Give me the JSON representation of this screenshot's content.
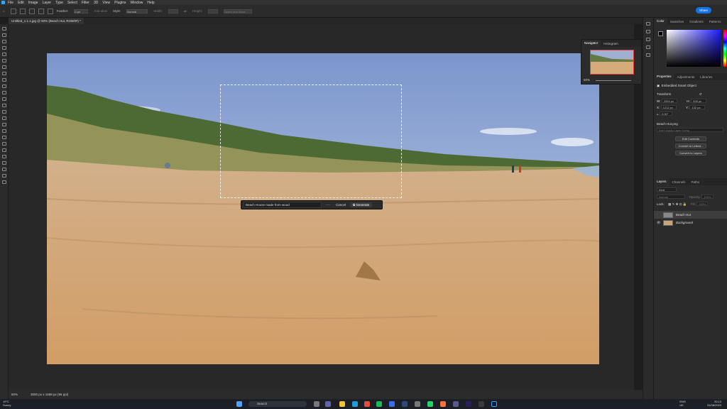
{
  "menubar": {
    "items": [
      "File",
      "Edit",
      "Image",
      "Layer",
      "Type",
      "Select",
      "Filter",
      "3D",
      "View",
      "Plugins",
      "Window",
      "Help"
    ]
  },
  "options": {
    "feather_label": "Feather:",
    "feather_value": "0 px",
    "antialias": "Anti-alias",
    "style_label": "Style:",
    "style_value": "Normal",
    "width_label": "Width:",
    "height_label": "Height:",
    "select_mask": "Select and Mask...",
    "share": "Share"
  },
  "doc_tab": {
    "title": "Untitled_1.1.1.jpg @ 50% (Beach Hut, RGB/8#) *"
  },
  "generative": {
    "prompt": "Beach House made from wood",
    "more": "···",
    "cancel": "Cancel",
    "generate": "Generate"
  },
  "status": {
    "zoom": "50%",
    "doc_size": "3000 px x 1688 px (96 ppi)"
  },
  "navigator": {
    "tabs": [
      "Navigator",
      "Histogram"
    ],
    "zoom": "50%"
  },
  "color_panel": {
    "tabs": [
      "Color",
      "Swatches",
      "Gradients",
      "Patterns"
    ],
    "accent": "#1e1cff"
  },
  "properties": {
    "tabs": [
      "Properties",
      "Adjustments",
      "Libraries"
    ],
    "object_type": "Embedded Smart Object",
    "transform_label": "Transform",
    "w": "2394 px",
    "h": "928 px",
    "x": "1212 px",
    "y": "132 px",
    "angle": "0.00°",
    "file_name": "Beach Hut.png",
    "layer_comp": "Don't Apply Layer Comp",
    "btn_edit": "Edit Contents",
    "btn_convert_linked": "Convert to Linked...",
    "btn_convert_layers": "Convert to Layers"
  },
  "layers": {
    "tabs": [
      "Layers",
      "Channels",
      "Paths"
    ],
    "filter": "Kind",
    "mode": "Normal",
    "opacity_label": "Opacity:",
    "opacity": "100%",
    "lock_label": "Lock:",
    "fill_label": "Fill:",
    "fill": "100%",
    "items": [
      {
        "name": "Beach Hut"
      },
      {
        "name": "Background"
      }
    ]
  },
  "taskbar": {
    "temp": "19°C",
    "weather": "Sunny",
    "search": "Search",
    "lang": "ENG\nUK",
    "time": "20:13",
    "date": "31/08/2023"
  }
}
